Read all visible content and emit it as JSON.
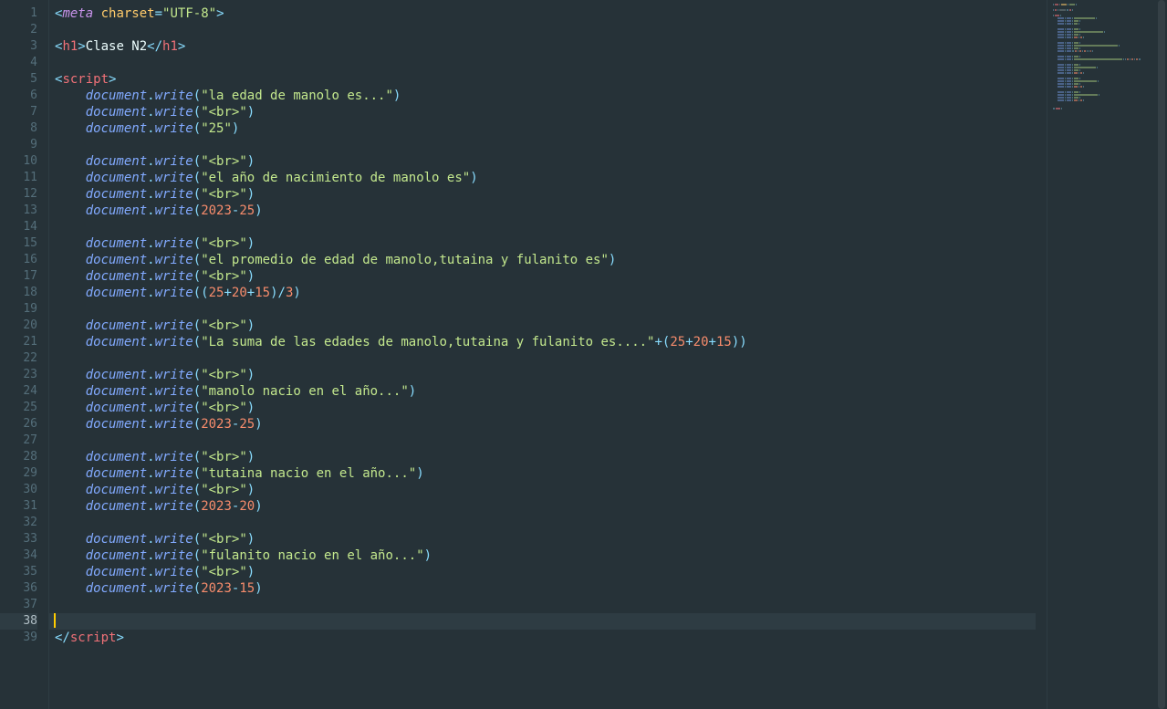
{
  "editor": {
    "total_lines": 39,
    "current_line": 38,
    "lines": [
      {
        "n": 1,
        "indent": 0,
        "tokens": [
          [
            "t-punc",
            "<"
          ],
          [
            "t-kw",
            "meta"
          ],
          [
            "t-text",
            " "
          ],
          [
            "t-attr",
            "charset"
          ],
          [
            "t-punc",
            "="
          ],
          [
            "t-str",
            "\"UTF-8\""
          ],
          [
            "t-punc",
            ">"
          ]
        ]
      },
      {
        "n": 2,
        "indent": 0,
        "tokens": []
      },
      {
        "n": 3,
        "indent": 0,
        "tokens": [
          [
            "t-punc",
            "<"
          ],
          [
            "t-tag",
            "h1"
          ],
          [
            "t-punc",
            ">"
          ],
          [
            "t-text",
            "Clase N2"
          ],
          [
            "t-punc",
            "</"
          ],
          [
            "t-tag",
            "h1"
          ],
          [
            "t-punc",
            ">"
          ]
        ]
      },
      {
        "n": 4,
        "indent": 0,
        "tokens": []
      },
      {
        "n": 5,
        "indent": 0,
        "tokens": [
          [
            "t-punc",
            "<"
          ],
          [
            "t-tag",
            "script"
          ],
          [
            "t-punc",
            ">"
          ]
        ]
      },
      {
        "n": 6,
        "indent": 1,
        "tokens": [
          [
            "t-obj",
            "document"
          ],
          [
            "t-punc",
            "."
          ],
          [
            "t-fn",
            "write"
          ],
          [
            "t-punc",
            "("
          ],
          [
            "t-str",
            "\"la edad de manolo es...\""
          ],
          [
            "t-punc",
            ")"
          ]
        ]
      },
      {
        "n": 7,
        "indent": 1,
        "tokens": [
          [
            "t-obj",
            "document"
          ],
          [
            "t-punc",
            "."
          ],
          [
            "t-fn",
            "write"
          ],
          [
            "t-punc",
            "("
          ],
          [
            "t-str",
            "\"<br>\""
          ],
          [
            "t-punc",
            ")"
          ]
        ]
      },
      {
        "n": 8,
        "indent": 1,
        "tokens": [
          [
            "t-obj",
            "document"
          ],
          [
            "t-punc",
            "."
          ],
          [
            "t-fn",
            "write"
          ],
          [
            "t-punc",
            "("
          ],
          [
            "t-str",
            "\"25\""
          ],
          [
            "t-punc",
            ")"
          ]
        ]
      },
      {
        "n": 9,
        "indent": 0,
        "tokens": []
      },
      {
        "n": 10,
        "indent": 1,
        "tokens": [
          [
            "t-obj",
            "document"
          ],
          [
            "t-punc",
            "."
          ],
          [
            "t-fn",
            "write"
          ],
          [
            "t-punc",
            "("
          ],
          [
            "t-str",
            "\"<br>\""
          ],
          [
            "t-punc",
            ")"
          ]
        ]
      },
      {
        "n": 11,
        "indent": 1,
        "tokens": [
          [
            "t-obj",
            "document"
          ],
          [
            "t-punc",
            "."
          ],
          [
            "t-fn",
            "write"
          ],
          [
            "t-punc",
            "("
          ],
          [
            "t-str",
            "\"el año de nacimiento de manolo es\""
          ],
          [
            "t-punc",
            ")"
          ]
        ]
      },
      {
        "n": 12,
        "indent": 1,
        "tokens": [
          [
            "t-obj",
            "document"
          ],
          [
            "t-punc",
            "."
          ],
          [
            "t-fn",
            "write"
          ],
          [
            "t-punc",
            "("
          ],
          [
            "t-str",
            "\"<br>\""
          ],
          [
            "t-punc",
            ")"
          ]
        ]
      },
      {
        "n": 13,
        "indent": 1,
        "tokens": [
          [
            "t-obj",
            "document"
          ],
          [
            "t-punc",
            "."
          ],
          [
            "t-fn",
            "write"
          ],
          [
            "t-punc",
            "("
          ],
          [
            "t-num",
            "2023"
          ],
          [
            "t-op",
            "-"
          ],
          [
            "t-num",
            "25"
          ],
          [
            "t-punc",
            ")"
          ]
        ]
      },
      {
        "n": 14,
        "indent": 0,
        "tokens": []
      },
      {
        "n": 15,
        "indent": 1,
        "tokens": [
          [
            "t-obj",
            "document"
          ],
          [
            "t-punc",
            "."
          ],
          [
            "t-fn",
            "write"
          ],
          [
            "t-punc",
            "("
          ],
          [
            "t-str",
            "\"<br>\""
          ],
          [
            "t-punc",
            ")"
          ]
        ]
      },
      {
        "n": 16,
        "indent": 1,
        "tokens": [
          [
            "t-obj",
            "document"
          ],
          [
            "t-punc",
            "."
          ],
          [
            "t-fn",
            "write"
          ],
          [
            "t-punc",
            "("
          ],
          [
            "t-str",
            "\"el promedio de edad de manolo,tutaina y fulanito es\""
          ],
          [
            "t-punc",
            ")"
          ]
        ]
      },
      {
        "n": 17,
        "indent": 1,
        "tokens": [
          [
            "t-obj",
            "document"
          ],
          [
            "t-punc",
            "."
          ],
          [
            "t-fn",
            "write"
          ],
          [
            "t-punc",
            "("
          ],
          [
            "t-str",
            "\"<br>\""
          ],
          [
            "t-punc",
            ")"
          ]
        ]
      },
      {
        "n": 18,
        "indent": 1,
        "tokens": [
          [
            "t-obj",
            "document"
          ],
          [
            "t-punc",
            "."
          ],
          [
            "t-fn",
            "write"
          ],
          [
            "t-punc",
            "(("
          ],
          [
            "t-num",
            "25"
          ],
          [
            "t-op",
            "+"
          ],
          [
            "t-num",
            "20"
          ],
          [
            "t-op",
            "+"
          ],
          [
            "t-num",
            "15"
          ],
          [
            "t-punc",
            ")"
          ],
          [
            "t-op",
            "/"
          ],
          [
            "t-num",
            "3"
          ],
          [
            "t-punc",
            ")"
          ]
        ]
      },
      {
        "n": 19,
        "indent": 0,
        "tokens": []
      },
      {
        "n": 20,
        "indent": 1,
        "tokens": [
          [
            "t-obj",
            "document"
          ],
          [
            "t-punc",
            "."
          ],
          [
            "t-fn",
            "write"
          ],
          [
            "t-punc",
            "("
          ],
          [
            "t-str",
            "\"<br>\""
          ],
          [
            "t-punc",
            ")"
          ]
        ]
      },
      {
        "n": 21,
        "indent": 1,
        "tokens": [
          [
            "t-obj",
            "document"
          ],
          [
            "t-punc",
            "."
          ],
          [
            "t-fn",
            "write"
          ],
          [
            "t-punc",
            "("
          ],
          [
            "t-str",
            "\"La suma de las edades de manolo,tutaina y fulanito es....\""
          ],
          [
            "t-op",
            "+"
          ],
          [
            "t-punc",
            "("
          ],
          [
            "t-num",
            "25"
          ],
          [
            "t-op",
            "+"
          ],
          [
            "t-num",
            "20"
          ],
          [
            "t-op",
            "+"
          ],
          [
            "t-num",
            "15"
          ],
          [
            "t-punc",
            "))"
          ]
        ]
      },
      {
        "n": 22,
        "indent": 0,
        "tokens": []
      },
      {
        "n": 23,
        "indent": 1,
        "tokens": [
          [
            "t-obj",
            "document"
          ],
          [
            "t-punc",
            "."
          ],
          [
            "t-fn",
            "write"
          ],
          [
            "t-punc",
            "("
          ],
          [
            "t-str",
            "\"<br>\""
          ],
          [
            "t-punc",
            ")"
          ]
        ]
      },
      {
        "n": 24,
        "indent": 1,
        "tokens": [
          [
            "t-obj",
            "document"
          ],
          [
            "t-punc",
            "."
          ],
          [
            "t-fn",
            "write"
          ],
          [
            "t-punc",
            "("
          ],
          [
            "t-str",
            "\"manolo nacio en el año...\""
          ],
          [
            "t-punc",
            ")"
          ]
        ]
      },
      {
        "n": 25,
        "indent": 1,
        "tokens": [
          [
            "t-obj",
            "document"
          ],
          [
            "t-punc",
            "."
          ],
          [
            "t-fn",
            "write"
          ],
          [
            "t-punc",
            "("
          ],
          [
            "t-str",
            "\"<br>\""
          ],
          [
            "t-punc",
            ")"
          ]
        ]
      },
      {
        "n": 26,
        "indent": 1,
        "tokens": [
          [
            "t-obj",
            "document"
          ],
          [
            "t-punc",
            "."
          ],
          [
            "t-fn",
            "write"
          ],
          [
            "t-punc",
            "("
          ],
          [
            "t-num",
            "2023"
          ],
          [
            "t-op",
            "-"
          ],
          [
            "t-num",
            "25"
          ],
          [
            "t-punc",
            ")"
          ]
        ]
      },
      {
        "n": 27,
        "indent": 0,
        "tokens": []
      },
      {
        "n": 28,
        "indent": 1,
        "tokens": [
          [
            "t-obj",
            "document"
          ],
          [
            "t-punc",
            "."
          ],
          [
            "t-fn",
            "write"
          ],
          [
            "t-punc",
            "("
          ],
          [
            "t-str",
            "\"<br>\""
          ],
          [
            "t-punc",
            ")"
          ]
        ]
      },
      {
        "n": 29,
        "indent": 1,
        "tokens": [
          [
            "t-obj",
            "document"
          ],
          [
            "t-punc",
            "."
          ],
          [
            "t-fn",
            "write"
          ],
          [
            "t-punc",
            "("
          ],
          [
            "t-str",
            "\"tutaina nacio en el año...\""
          ],
          [
            "t-punc",
            ")"
          ]
        ]
      },
      {
        "n": 30,
        "indent": 1,
        "tokens": [
          [
            "t-obj",
            "document"
          ],
          [
            "t-punc",
            "."
          ],
          [
            "t-fn",
            "write"
          ],
          [
            "t-punc",
            "("
          ],
          [
            "t-str",
            "\"<br>\""
          ],
          [
            "t-punc",
            ")"
          ]
        ]
      },
      {
        "n": 31,
        "indent": 1,
        "tokens": [
          [
            "t-obj",
            "document"
          ],
          [
            "t-punc",
            "."
          ],
          [
            "t-fn",
            "write"
          ],
          [
            "t-punc",
            "("
          ],
          [
            "t-num",
            "2023"
          ],
          [
            "t-op",
            "-"
          ],
          [
            "t-num",
            "20"
          ],
          [
            "t-punc",
            ")"
          ]
        ]
      },
      {
        "n": 32,
        "indent": 0,
        "tokens": []
      },
      {
        "n": 33,
        "indent": 1,
        "tokens": [
          [
            "t-obj",
            "document"
          ],
          [
            "t-punc",
            "."
          ],
          [
            "t-fn",
            "write"
          ],
          [
            "t-punc",
            "("
          ],
          [
            "t-str",
            "\"<br>\""
          ],
          [
            "t-punc",
            ")"
          ]
        ]
      },
      {
        "n": 34,
        "indent": 1,
        "tokens": [
          [
            "t-obj",
            "document"
          ],
          [
            "t-punc",
            "."
          ],
          [
            "t-fn",
            "write"
          ],
          [
            "t-punc",
            "("
          ],
          [
            "t-str",
            "\"fulanito nacio en el año...\""
          ],
          [
            "t-punc",
            ")"
          ]
        ]
      },
      {
        "n": 35,
        "indent": 1,
        "tokens": [
          [
            "t-obj",
            "document"
          ],
          [
            "t-punc",
            "."
          ],
          [
            "t-fn",
            "write"
          ],
          [
            "t-punc",
            "("
          ],
          [
            "t-str",
            "\"<br>\""
          ],
          [
            "t-punc",
            ")"
          ]
        ]
      },
      {
        "n": 36,
        "indent": 1,
        "tokens": [
          [
            "t-obj",
            "document"
          ],
          [
            "t-punc",
            "."
          ],
          [
            "t-fn",
            "write"
          ],
          [
            "t-punc",
            "("
          ],
          [
            "t-num",
            "2023"
          ],
          [
            "t-op",
            "-"
          ],
          [
            "t-num",
            "15"
          ],
          [
            "t-punc",
            ")"
          ]
        ]
      },
      {
        "n": 37,
        "indent": 0,
        "tokens": []
      },
      {
        "n": 38,
        "indent": 0,
        "tokens": [],
        "cursor": true
      },
      {
        "n": 39,
        "indent": 0,
        "tokens": [
          [
            "t-punc",
            "</"
          ],
          [
            "t-tag",
            "script"
          ],
          [
            "t-punc",
            ">"
          ]
        ]
      }
    ]
  }
}
